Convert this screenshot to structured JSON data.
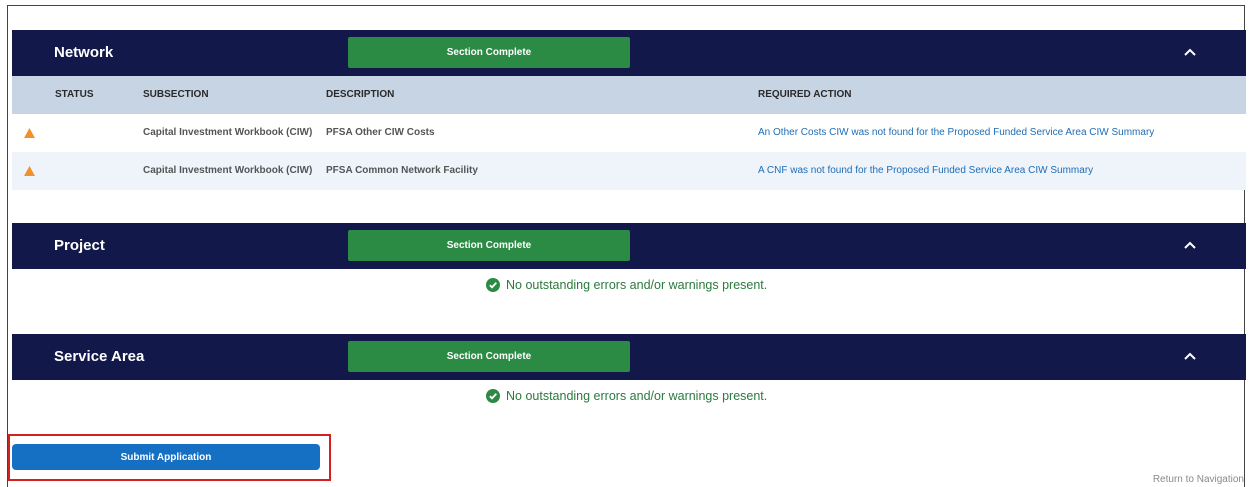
{
  "network": {
    "title": "Network",
    "status_button": "Section Complete",
    "columns": {
      "status": "STATUS",
      "subsection": "SUBSECTION",
      "description": "DESCRIPTION",
      "required_action": "REQUIRED ACTION"
    },
    "rows": [
      {
        "status_icon": "warning-icon",
        "subsection": "Capital Investment Workbook (CIW)",
        "description": "PFSA Other CIW Costs",
        "required_action": "An Other Costs CIW was not found for the Proposed Funded Service Area CIW Summary"
      },
      {
        "status_icon": "warning-icon",
        "subsection": "Capital Investment Workbook (CIW)",
        "description": "PFSA Common Network Facility",
        "required_action": "A CNF was not found for the Proposed Funded Service Area CIW Summary"
      }
    ]
  },
  "project": {
    "title": "Project",
    "status_button": "Section Complete",
    "message": "No outstanding errors and/or warnings present."
  },
  "service_area": {
    "title": "Service Area",
    "status_button": "Section Complete",
    "message": "No outstanding errors and/or warnings present."
  },
  "submit_label": "Submit Application",
  "return_link": "Return to Navigation",
  "colors": {
    "header_bg": "#12194a",
    "complete_green": "#2b8a44",
    "table_head_bg": "#c7d4e3",
    "link_blue": "#1e6db6",
    "warning_orange": "#f0912c",
    "success_green": "#2b7a3d",
    "submit_blue": "#1570c4",
    "highlight_red": "#d32020"
  }
}
